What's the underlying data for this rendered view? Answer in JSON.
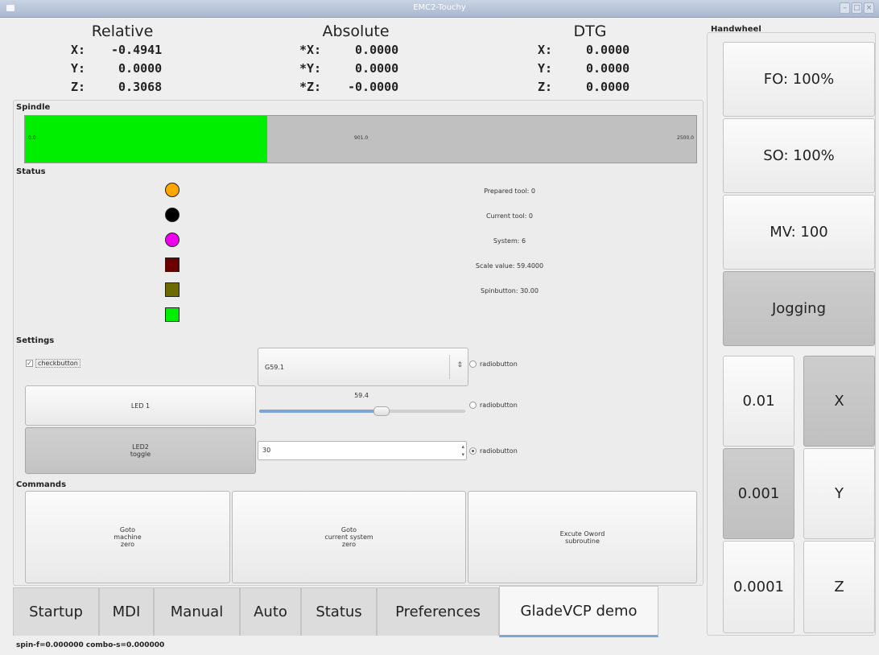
{
  "window": {
    "title": "EMC2-Touchy"
  },
  "dro": {
    "columns": [
      {
        "heading": "Relative",
        "rows": [
          {
            "axis": "X:",
            "value": "-0.4941"
          },
          {
            "axis": "Y:",
            "value": " 0.0000"
          },
          {
            "axis": "Z:",
            "value": " 0.3068"
          }
        ]
      },
      {
        "heading": "Absolute",
        "rows": [
          {
            "axis": "*X:",
            "value": " 0.0000"
          },
          {
            "axis": "*Y:",
            "value": " 0.0000"
          },
          {
            "axis": "*Z:",
            "value": "-0.0000"
          }
        ]
      },
      {
        "heading": "DTG",
        "rows": [
          {
            "axis": "X:",
            "value": "0.0000"
          },
          {
            "axis": "Y:",
            "value": "0.0000"
          },
          {
            "axis": "Z:",
            "value": "0.0000"
          }
        ]
      }
    ]
  },
  "spindle": {
    "label": "Spindle",
    "min_label": "0.0",
    "value_label": "901.0",
    "max_label": "2500.0",
    "min": 0,
    "value": 901.0,
    "max": 2500,
    "fill_color": "#00ee00"
  },
  "status": {
    "label": "Status",
    "leds": [
      {
        "shape": "circle",
        "color": "#ffa500"
      },
      {
        "shape": "circle",
        "color": "#000000"
      },
      {
        "shape": "circle",
        "color": "#ee00ee"
      },
      {
        "shape": "square",
        "color": "#6b0000"
      },
      {
        "shape": "square",
        "color": "#6b6b00"
      },
      {
        "shape": "square",
        "color": "#00ee00"
      }
    ],
    "texts": [
      "Prepared tool: 0",
      "Current tool: 0",
      "System: 6",
      "Scale value: 59.4000",
      "Spinbutton: 30.00"
    ]
  },
  "settings": {
    "label": "Settings",
    "checkbutton_label": "checkbutton",
    "combo_value": "G59.1",
    "led1_label": "LED 1",
    "led2_label": "LED2\ntoggle",
    "scale_value": "59.4",
    "scale_fraction": 0.594,
    "spin_value": "30",
    "radios": [
      "radiobutton",
      "radiobutton",
      "radiobutton"
    ]
  },
  "commands": {
    "label": "Commands",
    "buttons": [
      "Goto\nmachine\nzero",
      "Goto\ncurrent system\nzero",
      "Excute Oword\nsubroutine"
    ]
  },
  "tabs": [
    "Startup",
    "MDI",
    "Manual",
    "Auto",
    "Status",
    "Preferences",
    "GladeVCP demo"
  ],
  "active_tab": "GladeVCP demo",
  "handwheel": {
    "label": "Handwheel",
    "fo": "FO: 100%",
    "so": "SO: 100%",
    "mv": "MV: 100",
    "jogging": "Jogging",
    "increments": [
      "0.01",
      "0.001",
      "0.0001"
    ],
    "axes": [
      "X",
      "Y",
      "Z"
    ]
  },
  "statusbar": "spin-f=0.000000 combo-s=0.000000"
}
